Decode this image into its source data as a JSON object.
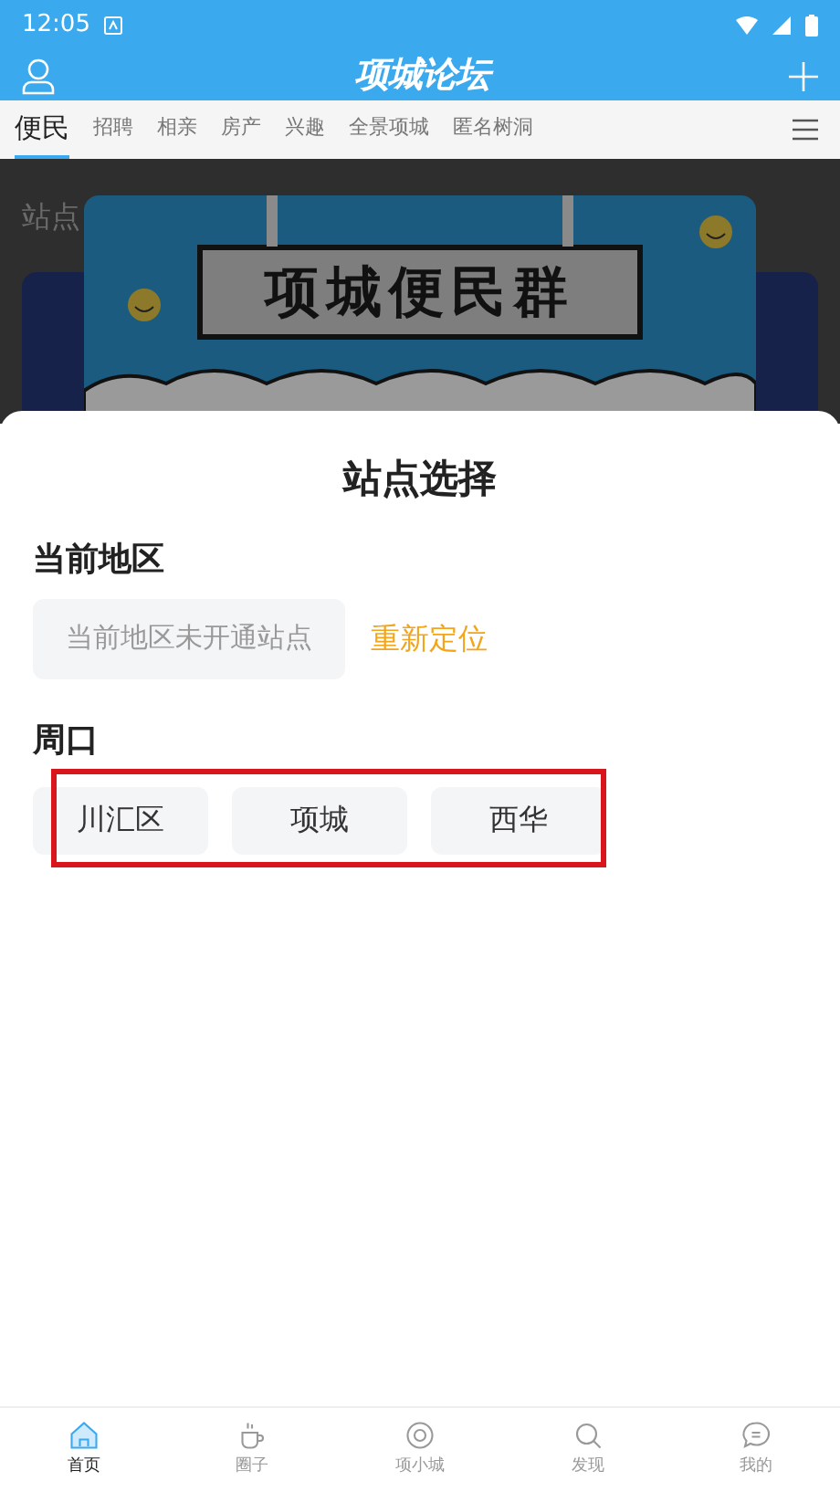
{
  "status_bar": {
    "time": "12:05"
  },
  "header": {
    "title": "项城论坛"
  },
  "tabs": [
    {
      "label": "便民",
      "selected": true
    },
    {
      "label": "招聘",
      "selected": false
    },
    {
      "label": "相亲",
      "selected": false
    },
    {
      "label": "房产",
      "selected": false
    },
    {
      "label": "兴趣",
      "selected": false
    },
    {
      "label": "全景项城",
      "selected": false
    },
    {
      "label": "匿名树洞",
      "selected": false
    }
  ],
  "background": {
    "section_title": "站点",
    "banner_text": "项城便民群"
  },
  "sheet": {
    "title": "站点选择",
    "current": {
      "heading": "当前地区",
      "status": "当前地区未开通站点",
      "relocate": "重新定位"
    },
    "regions": [
      {
        "heading": "周口",
        "highlighted": true,
        "sites": [
          "川汇区",
          "项城",
          "西华"
        ]
      }
    ]
  },
  "bottom_nav": [
    {
      "label": "首页",
      "kind": "home",
      "selected": true
    },
    {
      "label": "圈子",
      "kind": "cup",
      "selected": false
    },
    {
      "label": "项小城",
      "kind": "ring",
      "selected": false
    },
    {
      "label": "发现",
      "kind": "search",
      "selected": false
    },
    {
      "label": "我的",
      "kind": "chat",
      "selected": false
    }
  ]
}
